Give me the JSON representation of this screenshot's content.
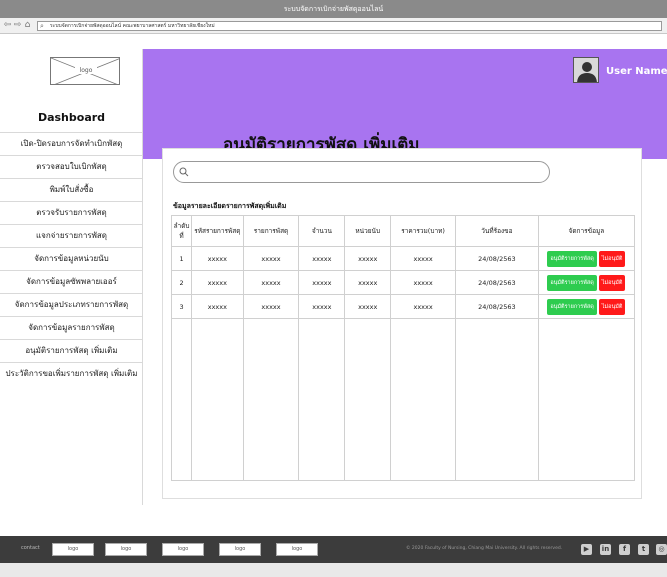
{
  "window": {
    "title": "ระบบจัดการเบิกจ่ายพัสดุออนไลน์"
  },
  "browser": {
    "url": "ระบบจัดการเบิกจ่ายพัสดุออนไลน์ คณะพยาบาลศาสตร์ มหาวิทยาลัยเชียงใหม่"
  },
  "sidebar": {
    "logo_label": "logo",
    "title": "Dashboard",
    "items": [
      "เปิด-ปิดรอบการจัดทำเบิกพัสดุ",
      "ตรวจสอบใบเบิกพัสดุ",
      "พิมพ์ใบสั่งซื้อ",
      "ตรวจรับรายการพัสดุ",
      "แจกจ่ายรายการพัสดุ",
      "จัดการข้อมูลหน่วยนับ",
      "จัดการข้อมูลซัพพลายเออร์",
      "จัดการข้อมูลประเภทรายการพัสดุ",
      "จัดการข้อมูลรายการพัสดุ",
      "อนุมัติรายการพัสดุ เพิ่มเติม",
      "ประวัติการขอเพิ่มรายการพัสดุ เพิ่มเติม"
    ]
  },
  "header": {
    "user_name": "User Name",
    "page_title": "อนุมัติรายการพัสดุ เพิ่มเติม"
  },
  "main": {
    "search_placeholder": "",
    "section_title": "ข้อมูลรายละเอียดรายการพัสดุเพิ่มเติม",
    "table": {
      "headers": [
        "ลำดับที่",
        "รหัสรายการพัสดุ",
        "รายการพัสดุ",
        "จำนวน",
        "หน่วยนับ",
        "ราคารวม(บาท)",
        "วันที่ร้องขอ",
        "จัดการข้อมูล"
      ],
      "rows": [
        {
          "no": "1",
          "code": "xxxxx",
          "name": "xxxxx",
          "qty": "xxxxx",
          "unit": "xxxxx",
          "total": "xxxxx",
          "date": "24/08/2563"
        },
        {
          "no": "2",
          "code": "xxxxx",
          "name": "xxxxx",
          "qty": "xxxxx",
          "unit": "xxxxx",
          "total": "xxxxx",
          "date": "24/08/2563"
        },
        {
          "no": "3",
          "code": "xxxxx",
          "name": "xxxxx",
          "qty": "xxxxx",
          "unit": "xxxxx",
          "total": "xxxxx",
          "date": "24/08/2563"
        }
      ],
      "approve_label": "อนุมัติรายการพัสดุ",
      "reject_label": "ไม่อนุมัติ"
    }
  },
  "footer": {
    "contact_label": "contact",
    "logo_label": "logo",
    "copyright": "© 2020 Faculty of Nursing, Chiang Mai University. All rights reserved."
  },
  "colors": {
    "header_purple": "#a874f0",
    "approve_green": "#2ecc4f",
    "reject_red": "#ff1a1a",
    "footer_dark": "#3c3c3c"
  }
}
